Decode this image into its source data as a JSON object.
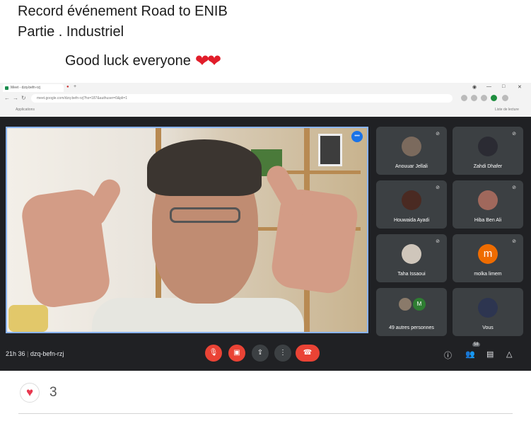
{
  "post": {
    "line1": "Record événement Road to ENIB",
    "line2": "Partie . Industriel",
    "line3": "Good luck everyone",
    "line3_emoji": "❤❤"
  },
  "browser": {
    "tab_title": "Meet - dzq-befn-rzj",
    "url": "meet.google.com/dzq-befn-rzj?hs=187&authuser=0&pli=1",
    "bookmark_label": "Applications",
    "profile_label": "Liste de lecture"
  },
  "meet": {
    "speaking_badge": "•••",
    "meeting_time": "21h 36",
    "meeting_code": "dzq-befn-rzj",
    "participants": [
      {
        "name": "Anouuar Jellali"
      },
      {
        "name": "Zahdi Dhafer"
      },
      {
        "name": "Houwaida Ayadi"
      },
      {
        "name": "Hiba Ben Ali"
      },
      {
        "name": "Taha Issaoui"
      },
      {
        "name": "molka limem",
        "initial": "m"
      },
      {
        "name": "49 autres personnes",
        "initial": "M"
      },
      {
        "name": "Vous"
      }
    ],
    "people_count": "58"
  },
  "reactions": {
    "count": "3"
  },
  "colors": {
    "meet_bg": "#202124",
    "tile_bg": "#3c4043",
    "end_call": "#ea4335",
    "heart": "#e8384f"
  }
}
